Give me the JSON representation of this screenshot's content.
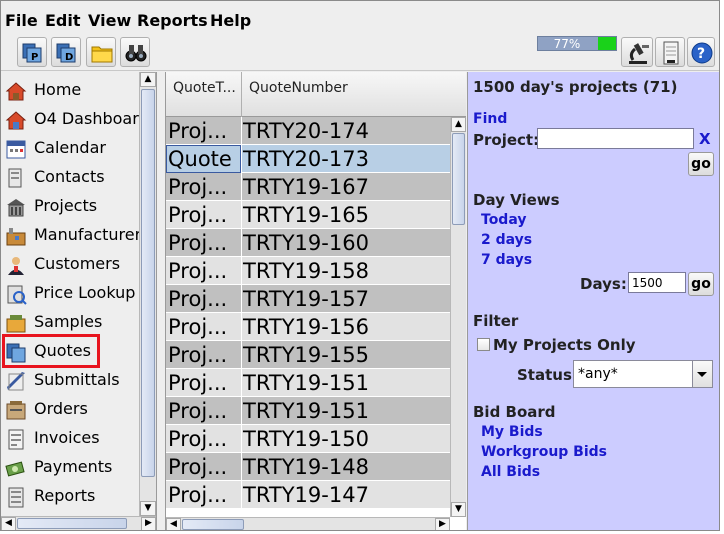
{
  "menu": [
    "File",
    "Edit",
    "View",
    "Reports",
    "Help"
  ],
  "toolbar": {
    "buttons": [
      "projects-icon",
      "documents-icon",
      "folder-icon",
      "binoculars-icon"
    ],
    "memory_text": "77%",
    "memory_fraction": 0.77,
    "right_buttons": [
      "microscope-icon",
      "notepad-icon",
      "help-icon"
    ]
  },
  "nav": {
    "items": [
      {
        "label": "Home",
        "icon": "home-icon"
      },
      {
        "label": "O4 Dashboard",
        "icon": "dashboard-icon"
      },
      {
        "label": "Calendar",
        "icon": "calendar-icon"
      },
      {
        "label": "Contacts",
        "icon": "contacts-icon"
      },
      {
        "label": "Projects",
        "icon": "projects-icon"
      },
      {
        "label": "Manufacturers",
        "icon": "manufacturers-icon"
      },
      {
        "label": "Customers",
        "icon": "customers-icon"
      },
      {
        "label": "Price Lookup",
        "icon": "price-lookup-icon"
      },
      {
        "label": "Samples",
        "icon": "samples-icon"
      },
      {
        "label": "Quotes",
        "icon": "quotes-icon"
      },
      {
        "label": "Submittals",
        "icon": "submittals-icon"
      },
      {
        "label": "Orders",
        "icon": "orders-icon"
      },
      {
        "label": "Invoices",
        "icon": "invoices-icon"
      },
      {
        "label": "Payments",
        "icon": "payments-icon"
      },
      {
        "label": "Reports",
        "icon": "reports-icon"
      }
    ],
    "selected": "Quotes"
  },
  "table": {
    "columns": [
      "QuoteT...",
      "QuoteNumber"
    ],
    "rows": [
      {
        "type": "Proj...",
        "number": "TRTY20-174"
      },
      {
        "type": "Quote",
        "number": "TRTY20-173"
      },
      {
        "type": "Proj...",
        "number": "TRTY19-167"
      },
      {
        "type": "Proj...",
        "number": "TRTY19-165"
      },
      {
        "type": "Proj...",
        "number": "TRTY19-160"
      },
      {
        "type": "Proj...",
        "number": "TRTY19-158"
      },
      {
        "type": "Proj...",
        "number": "TRTY19-157"
      },
      {
        "type": "Proj...",
        "number": "TRTY19-156"
      },
      {
        "type": "Proj...",
        "number": "TRTY19-155"
      },
      {
        "type": "Proj...",
        "number": "TRTY19-151"
      },
      {
        "type": "Proj...",
        "number": "TRTY19-151"
      },
      {
        "type": "Proj...",
        "number": "TRTY19-150"
      },
      {
        "type": "Proj...",
        "number": "TRTY19-148"
      },
      {
        "type": "Proj...",
        "number": "TRTY19-147"
      }
    ],
    "selected_row": 1,
    "colors": {
      "odd": "#c0c0c0",
      "even": "#e2e2e2",
      "selected": "#b8cfe5"
    }
  },
  "panel": {
    "title": "1500 day's projects (71)",
    "find_heading": "Find",
    "project_label": "Project:",
    "project_value": "",
    "clear_label": "X",
    "go_label": "go",
    "day_views_heading": "Day Views",
    "day_links": [
      "Today",
      "2 days",
      "7 days"
    ],
    "days_label": "Days:",
    "days_value": "1500",
    "filter_heading": "Filter",
    "my_projects_label": "My Projects Only",
    "my_projects_checked": false,
    "status_label": "Status:",
    "status_value": "*any*",
    "bid_board_heading": "Bid Board",
    "bid_links": [
      "My Bids",
      "Workgroup Bids",
      "All Bids"
    ],
    "background": "#ccccff",
    "link_color": "#1a1acc"
  }
}
